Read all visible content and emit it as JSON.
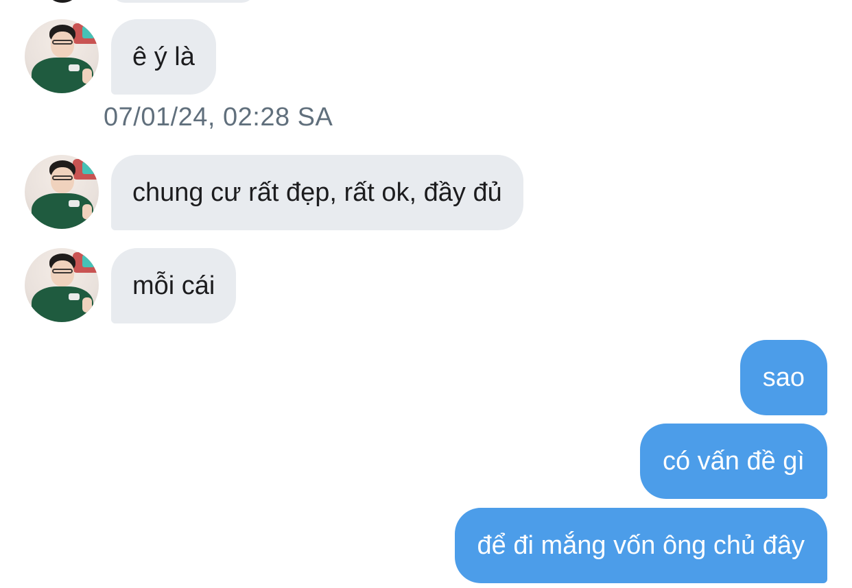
{
  "conversation": {
    "incoming": [
      {
        "text": "ê ý là"
      },
      {
        "text": "chung cư rất đẹp, rất ok, đầy đủ"
      },
      {
        "text": "mỗi cái"
      }
    ],
    "timestamp": "07/01/24, 02:28 SA",
    "outgoing": [
      {
        "text": "sao"
      },
      {
        "text": "có vấn đề gì"
      },
      {
        "text": "để đi mắng vốn ông chủ đây"
      }
    ]
  },
  "colors": {
    "incoming_bubble": "#e8ebef",
    "outgoing_bubble": "#4c9de9",
    "timestamp_text": "#606f7c"
  },
  "icons": [
    "contact-avatar"
  ]
}
